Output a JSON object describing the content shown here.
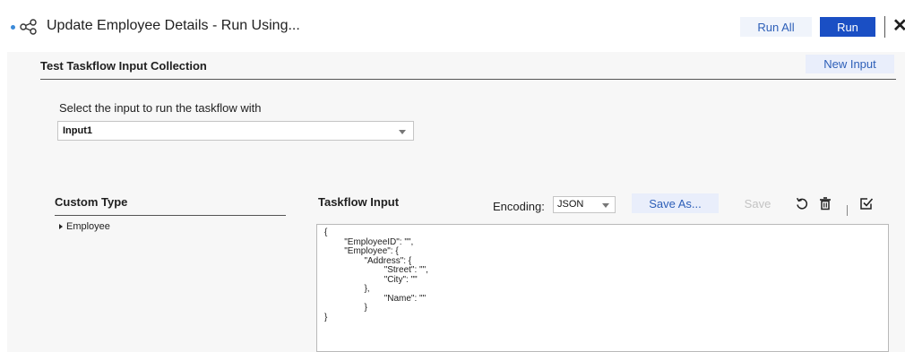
{
  "header": {
    "title": "Update Employee Details - Run Using...",
    "run_all_label": "Run All",
    "run_label": "Run",
    "close_glyph": "✕"
  },
  "collection": {
    "title": "Test Taskflow Input Collection",
    "new_input_label": "New Input"
  },
  "input_select": {
    "label": "Select the input to run the taskflow with",
    "value": "Input1"
  },
  "custom_type": {
    "title": "Custom Type",
    "items": [
      {
        "label": "Employee"
      }
    ]
  },
  "taskflow_input": {
    "title": "Taskflow Input",
    "encoding_label": "Encoding:",
    "encoding_value": "JSON",
    "save_as_label": "Save As...",
    "save_label": "Save",
    "content": "{\n\t\"EmployeeID\": \"\",\n\t\"Employee\": {\n\t\t\"Address\": {\n\t\t\t\"Street\": \"\",\n\t\t\t\"City\": \"\"\n\t\t},\n\t\t\t\"Name\": \"\"\n\t\t}\n}"
  },
  "icons": {
    "flow": "flow-icon",
    "reset": "reset-icon",
    "delete": "trash-icon",
    "validate": "validate-icon"
  },
  "colors": {
    "primary": "#1a4fc4",
    "link": "#2d5fb8",
    "accent_dot": "#3b8ad9"
  }
}
